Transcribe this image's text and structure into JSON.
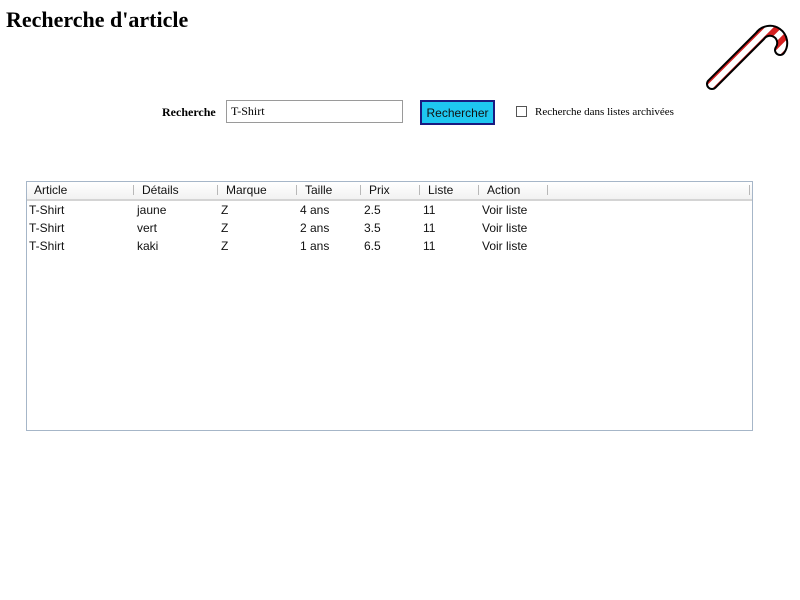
{
  "header": {
    "title": "Recherche d'article"
  },
  "search": {
    "label": "Recherche",
    "value": "T-Shirt",
    "button_label": "Rechercher",
    "archive_checkbox_checked": false,
    "archive_label": "Recherche dans listes archivées",
    "button_color": "#1ec7f0"
  },
  "results": {
    "columns": [
      "Article",
      "Détails",
      "Marque",
      "Taille",
      "Prix",
      "Liste",
      "Action"
    ],
    "rows": [
      {
        "article": "T-Shirt",
        "details": "jaune",
        "marque": "Z",
        "taille": "4 ans",
        "prix": "2.5",
        "liste": "11",
        "action": "Voir liste"
      },
      {
        "article": "T-Shirt",
        "details": "vert",
        "marque": "Z",
        "taille": "2 ans",
        "prix": "3.5",
        "liste": "11",
        "action": "Voir liste"
      },
      {
        "article": "T-Shirt",
        "details": "kaki",
        "marque": "Z",
        "taille": "1 ans",
        "prix": "6.5",
        "liste": "11",
        "action": "Voir liste"
      }
    ]
  },
  "decorations": {
    "corner_icon": "candy-cane-icon"
  }
}
